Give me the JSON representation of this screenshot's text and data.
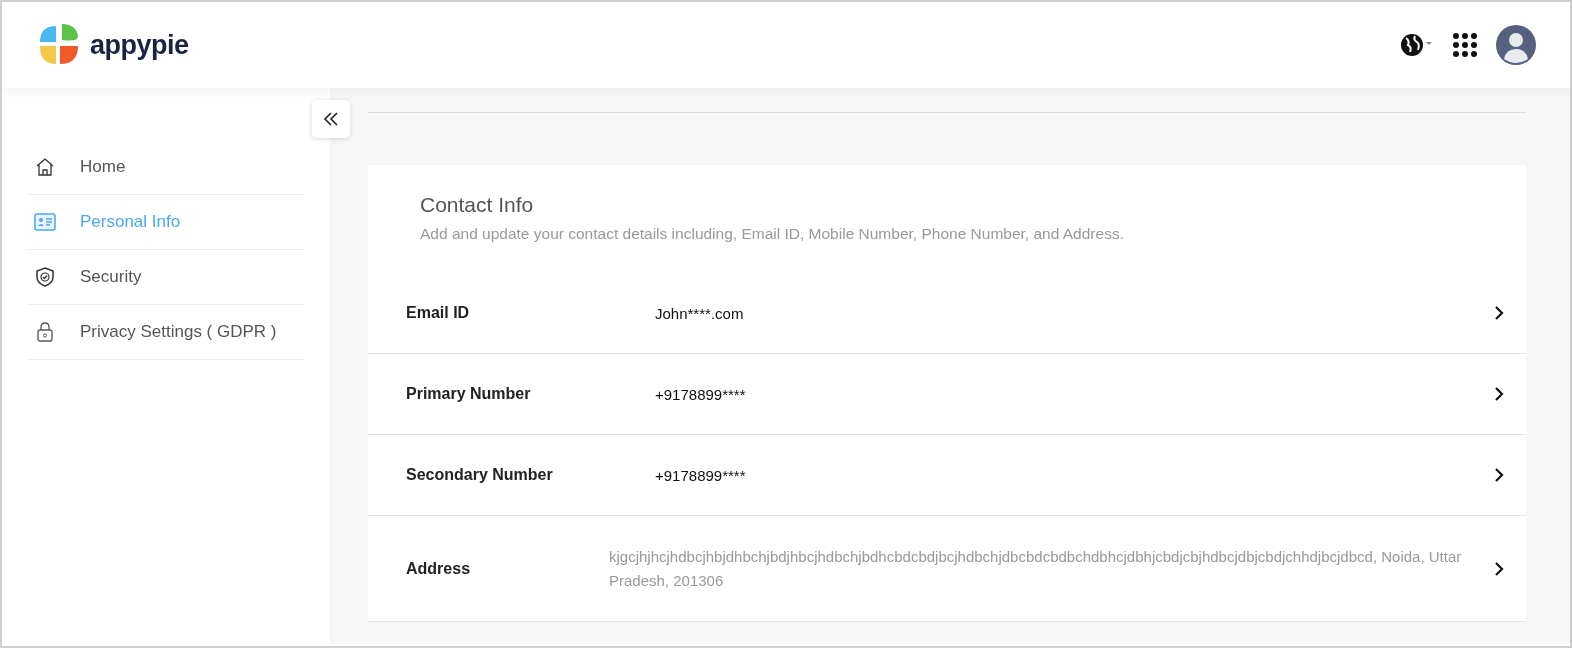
{
  "header": {
    "logo_text": "appypie"
  },
  "sidebar": {
    "items": [
      {
        "label": "Home",
        "kind": "home",
        "selected": false
      },
      {
        "label": "Personal Info",
        "kind": "card",
        "selected": true
      },
      {
        "label": "Security",
        "kind": "shield",
        "selected": false
      },
      {
        "label": "Privacy Settings ( GDPR )",
        "kind": "lock",
        "selected": false
      }
    ]
  },
  "section": {
    "title": "Contact Info",
    "description": "Add and update your contact details including, Email ID, Mobile Number, Phone Number, and Address.",
    "rows": [
      {
        "label": "Email ID",
        "value": "John****.com",
        "kind": "plain"
      },
      {
        "label": "Primary Number",
        "value": "+9178899****",
        "kind": "plain"
      },
      {
        "label": "Secondary Number",
        "value": "+9178899****",
        "kind": "plain"
      },
      {
        "label": "Address",
        "value": "kjgcjhjhcjhdbcjhbjdhbchjbdjhbcjhdbchjbdhcbdcbdjbcjhdbchjdbcbdcbdbchdbhcjdbhjcbdjcbjhdbcjdbjcbdjchhdjbcjdbcd, Noida, Uttar Pradesh, 201306",
        "kind": "long"
      }
    ]
  }
}
